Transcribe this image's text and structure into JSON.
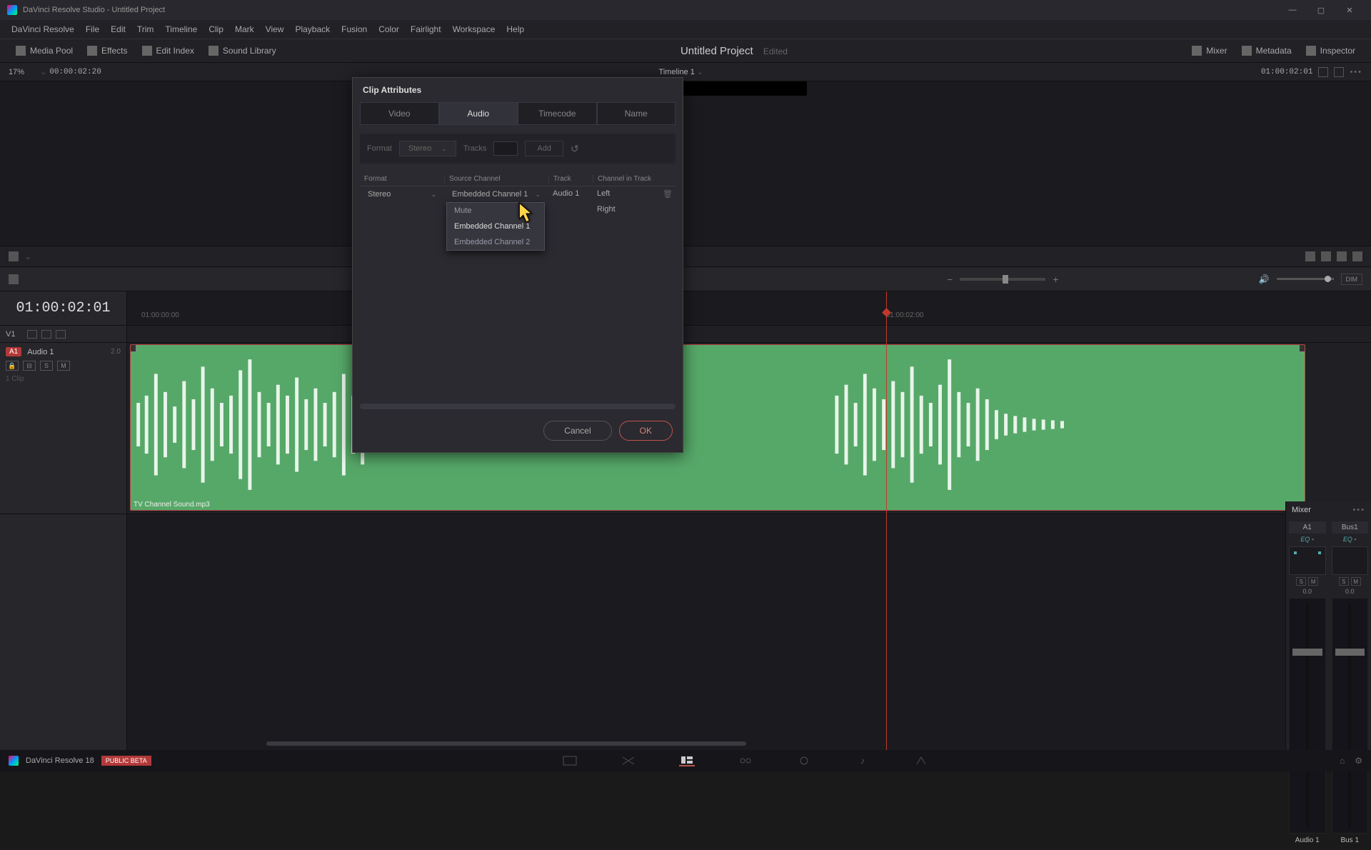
{
  "titlebar": {
    "title": "DaVinci Resolve Studio - Untitled Project"
  },
  "menubar": [
    "DaVinci Resolve",
    "File",
    "Edit",
    "Trim",
    "Timeline",
    "Clip",
    "Mark",
    "View",
    "Playback",
    "Fusion",
    "Color",
    "Fairlight",
    "Workspace",
    "Help"
  ],
  "toolbar": {
    "media_pool": "Media Pool",
    "effects": "Effects",
    "edit_index": "Edit Index",
    "sound_library": "Sound Library",
    "project": "Untitled Project",
    "edited": "Edited",
    "mixer": "Mixer",
    "metadata": "Metadata",
    "inspector": "Inspector"
  },
  "tlheader": {
    "zoom": "17%",
    "tc_left": "00:00:02:20",
    "name": "Timeline 1",
    "tc_right": "01:00:02:01"
  },
  "tlside": {
    "bigtc": "01:00:02:01",
    "v1": "V1",
    "a1_badge": "A1",
    "a1_name": "Audio 1",
    "a1_val": "2.0",
    "s": "S",
    "m": "M",
    "clips": "1 Clip"
  },
  "ruler": {
    "t0": "01:00:00:00",
    "t1": "01:00:02:00"
  },
  "clip": {
    "name": "TV Channel Sound.mp3"
  },
  "dialog": {
    "title": "Clip Attributes",
    "tabs": [
      "Video",
      "Audio",
      "Timecode",
      "Name"
    ],
    "active_tab": 1,
    "row1": {
      "format_label": "Format",
      "format_value": "Stereo",
      "tracks_label": "Tracks",
      "add": "Add"
    },
    "thead": [
      "Format",
      "Source Channel",
      "Track",
      "Channel in Track"
    ],
    "rows": [
      {
        "format": "Stereo",
        "source": "Embedded Channel 1",
        "track": "Audio 1",
        "chin": "Left"
      },
      {
        "format": "",
        "source": "Embedded Channel 1",
        "track": "",
        "chin": "Right"
      }
    ],
    "dropdown_options": [
      "Mute",
      "Embedded Channel 1",
      "Embedded Channel 2"
    ],
    "cancel": "Cancel",
    "ok": "OK"
  },
  "mixer": {
    "title": "Mixer",
    "cols": [
      {
        "ch": "A1",
        "eq": "EQ",
        "s": "S",
        "m": "M",
        "db": "0.0",
        "name": "Audio 1"
      },
      {
        "ch": "Bus1",
        "eq": "EQ",
        "s": "S",
        "m": "M",
        "db": "0.0",
        "name": "Bus 1"
      }
    ]
  },
  "bottombar": {
    "name": "DaVinci Resolve 18",
    "beta": "PUBLIC BETA"
  },
  "tltools": {
    "dim": "DIM"
  }
}
